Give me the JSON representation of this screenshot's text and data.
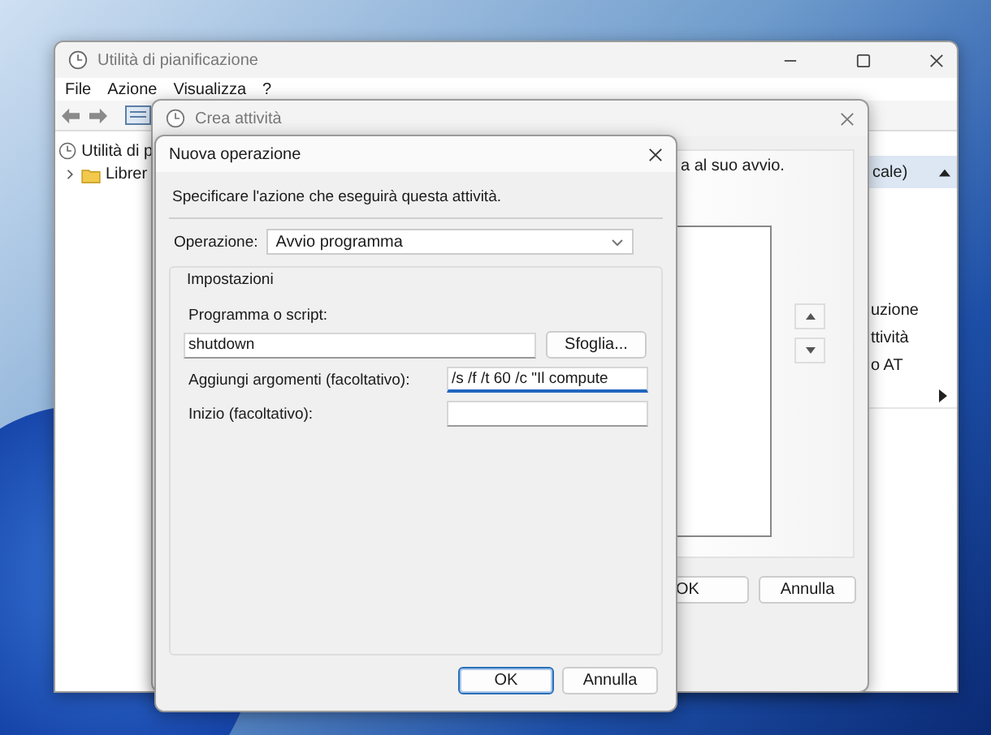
{
  "main_window": {
    "title": "Utilità di pianificazione",
    "menu": [
      "File",
      "Azione",
      "Visualizza",
      "?"
    ],
    "tree": [
      {
        "label": "Utilità di p",
        "children": [
          {
            "label": "Librer",
            "expanded": false
          }
        ]
      }
    ],
    "actions_pane": {
      "header": "cale)",
      "items": [
        {
          "label": "uzione",
          "kind": "text"
        },
        {
          "label": "ttività",
          "kind": "text"
        },
        {
          "label": "o AT",
          "kind": "text"
        },
        {
          "kind": "submenu"
        }
      ]
    }
  },
  "create_task": {
    "title": "Crea attività",
    "description": "a al suo avvio.",
    "buttons": [
      "OK",
      "Annulla"
    ]
  },
  "dialog": {
    "title": "Nuova operazione",
    "instruction": "Specificare l'azione che eseguirà questa attività.",
    "operation": {
      "label": "Operazione:",
      "value": "Avvio programma"
    },
    "group": {
      "title": "Impostazioni",
      "program": {
        "label": "Programma o script:",
        "value": "shutdown",
        "button": "Sfoglia..."
      },
      "arguments": {
        "label": "Aggiungi argomenti (facoltativo):",
        "value": "/s /f /t 60 /c \"Il compute",
        "focused": true
      },
      "start_in": {
        "label": "Inizio (facoltativo):",
        "focused": false
      }
    },
    "buttons": [
      {
        "label": "OK",
        "default": true
      },
      {
        "label": "Annulla",
        "default": false
      }
    ]
  }
}
